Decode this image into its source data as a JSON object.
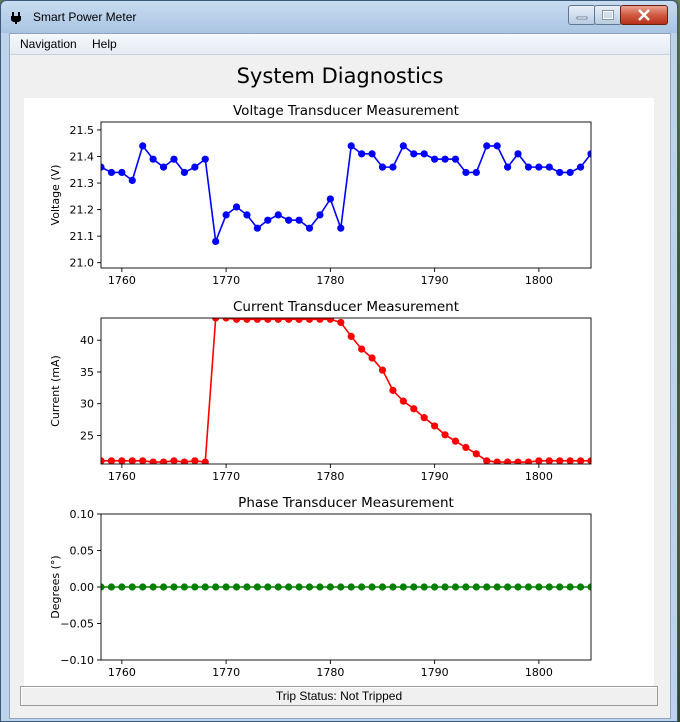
{
  "window": {
    "title": "Smart Power Meter"
  },
  "menu": {
    "items": [
      "Navigation",
      "Help"
    ]
  },
  "page": {
    "title": "System Diagnostics"
  },
  "status": {
    "text": "Trip Status: Not Tripped"
  },
  "icons": {
    "app": "power-plug-icon",
    "minimize": "minimize-icon",
    "maximize": "maximize-icon",
    "close": "close-icon"
  },
  "chart_data": [
    {
      "type": "line",
      "title": "Voltage Transducer Measurement",
      "xlabel": "",
      "ylabel": "Voltage (V)",
      "xlim": [
        1758,
        1805
      ],
      "ylim": [
        20.98,
        21.53
      ],
      "xticks": [
        1760,
        1770,
        1780,
        1790,
        1800
      ],
      "yticks": [
        21.0,
        21.1,
        21.2,
        21.3,
        21.4,
        21.5
      ],
      "ytick_labels": [
        "21.0",
        "21.1",
        "21.2",
        "21.3",
        "21.4",
        "21.5"
      ],
      "color": "#0000ff",
      "series": [
        {
          "x": [
            1758,
            1759,
            1760,
            1761,
            1762,
            1763,
            1764,
            1765,
            1766,
            1767,
            1768,
            1769,
            1770,
            1771,
            1772,
            1773,
            1774,
            1775,
            1776,
            1777,
            1778,
            1779,
            1780,
            1781,
            1782,
            1783,
            1784,
            1785,
            1786,
            1787,
            1788,
            1789,
            1790,
            1791,
            1792,
            1793,
            1794,
            1795,
            1796,
            1797,
            1798,
            1799,
            1800,
            1801,
            1802,
            1803,
            1804,
            1805
          ],
          "values": [
            21.36,
            21.34,
            21.34,
            21.31,
            21.44,
            21.39,
            21.36,
            21.39,
            21.34,
            21.36,
            21.39,
            21.08,
            21.18,
            21.21,
            21.18,
            21.13,
            21.16,
            21.18,
            21.16,
            21.16,
            21.13,
            21.18,
            21.24,
            21.13,
            21.44,
            21.41,
            21.41,
            21.36,
            21.36,
            21.44,
            21.41,
            21.41,
            21.39,
            21.39,
            21.39,
            21.34,
            21.34,
            21.44,
            21.44,
            21.36,
            21.41,
            21.36,
            21.36,
            21.36,
            21.34,
            21.34,
            21.36,
            21.41
          ]
        }
      ]
    },
    {
      "type": "line",
      "title": "Current Transducer Measurement",
      "xlabel": "",
      "ylabel": "Current (mA)",
      "xlim": [
        1758,
        1805
      ],
      "ylim": [
        20.5,
        43.5
      ],
      "xticks": [
        1760,
        1770,
        1780,
        1790,
        1800
      ],
      "yticks": [
        25,
        30,
        35,
        40
      ],
      "ytick_labels": [
        "25",
        "30",
        "35",
        "40"
      ],
      "color": "#ff0000",
      "series": [
        {
          "x": [
            1758,
            1759,
            1760,
            1761,
            1762,
            1763,
            1764,
            1765,
            1766,
            1767,
            1768,
            1769,
            1770,
            1771,
            1772,
            1773,
            1774,
            1775,
            1776,
            1777,
            1778,
            1779,
            1780,
            1781,
            1782,
            1783,
            1784,
            1785,
            1786,
            1787,
            1788,
            1789,
            1790,
            1791,
            1792,
            1793,
            1794,
            1795,
            1796,
            1797,
            1798,
            1799,
            1800,
            1801,
            1802,
            1803,
            1804,
            1805
          ],
          "values": [
            21,
            21,
            21,
            21,
            21,
            20.8,
            20.8,
            21,
            20.8,
            21,
            20.8,
            43.5,
            43.5,
            43.3,
            43.3,
            43.3,
            43.3,
            43.3,
            43.3,
            43.3,
            43.3,
            43.3,
            43.3,
            42.8,
            40.6,
            38.6,
            37.2,
            35.3,
            32.1,
            30.4,
            29.2,
            27.8,
            26.5,
            25.1,
            24.1,
            23.1,
            22.1,
            21,
            20.8,
            20.8,
            20.8,
            20.8,
            21,
            21,
            21,
            21,
            21,
            21
          ]
        }
      ]
    },
    {
      "type": "line",
      "title": "Phase Transducer Measurement",
      "xlabel": "",
      "ylabel": "Degrees (°)",
      "xlim": [
        1758,
        1805
      ],
      "ylim": [
        -0.1,
        0.1
      ],
      "xticks": [
        1760,
        1770,
        1780,
        1790,
        1800
      ],
      "yticks": [
        -0.1,
        -0.05,
        0.0,
        0.05,
        0.1
      ],
      "ytick_labels": [
        "−0.10",
        "−0.05",
        "0.00",
        "0.05",
        "0.10"
      ],
      "color": "#008000",
      "series": [
        {
          "x": [
            1758,
            1759,
            1760,
            1761,
            1762,
            1763,
            1764,
            1765,
            1766,
            1767,
            1768,
            1769,
            1770,
            1771,
            1772,
            1773,
            1774,
            1775,
            1776,
            1777,
            1778,
            1779,
            1780,
            1781,
            1782,
            1783,
            1784,
            1785,
            1786,
            1787,
            1788,
            1789,
            1790,
            1791,
            1792,
            1793,
            1794,
            1795,
            1796,
            1797,
            1798,
            1799,
            1800,
            1801,
            1802,
            1803,
            1804,
            1805
          ],
          "values": [
            0,
            0,
            0,
            0,
            0,
            0,
            0,
            0,
            0,
            0,
            0,
            0,
            0,
            0,
            0,
            0,
            0,
            0,
            0,
            0,
            0,
            0,
            0,
            0,
            0,
            0,
            0,
            0,
            0,
            0,
            0,
            0,
            0,
            0,
            0,
            0,
            0,
            0,
            0,
            0,
            0,
            0,
            0,
            0,
            0,
            0,
            0,
            0
          ]
        }
      ]
    }
  ]
}
